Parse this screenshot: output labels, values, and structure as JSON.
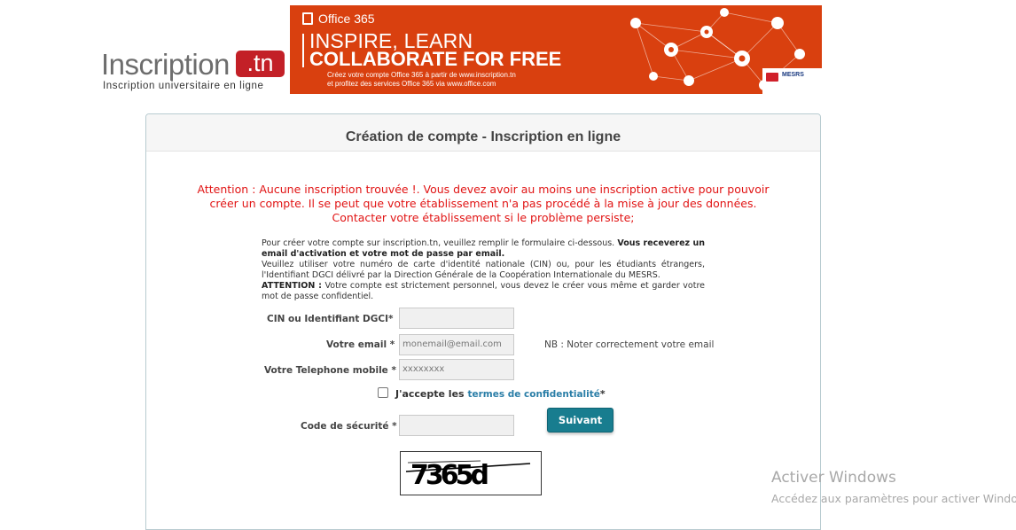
{
  "logo": {
    "word": "Inscription",
    "tld": ".tn",
    "tagline": "Inscription universitaire en ligne"
  },
  "banner": {
    "brand": "Office 365",
    "headline1": "INSPIRE, LEARN",
    "headline2": "COLLABORATE FOR FREE",
    "line1": "Créez votre compte Office 365 à partir de www.inscription.tn",
    "line2": "et profitez des services Office 365 via www.office.com",
    "badge": "MESRS",
    "accent": "#d9400f"
  },
  "panel": {
    "title": "Création de compte - Inscription en ligne"
  },
  "warning": {
    "line1": "Attention : Aucune inscription trouvée !. Vous devez avoir au moins une inscription active pour pouvoir",
    "line2": "créer un compte. Il se peut que votre établissement n'a pas procédé à la mise à jour des données.",
    "line3": "Contacter votre établissement si le problème persiste;"
  },
  "info": {
    "p1": "Pour créer votre compte sur inscription.tn, veuillez remplir le formulaire ci-dessous.",
    "p1_bold": "Vous receverez un email d'activation et votre mot de passe par email.",
    "p2": "Veuillez utiliser votre numéro de carte d'identité nationale (CIN) ou, pour les étudiants étrangers, l'Identifiant DGCI délivré par la Direction Générale de la Coopération Internationale du MESRS.",
    "p3_bold": "ATTENTION :",
    "p3": "Votre compte est strictement personnel, vous devez le créer vous même et garder votre mot de passe confidentiel."
  },
  "form": {
    "cin_label": "CIN ou Identifiant DGCI*",
    "cin_value": "",
    "email_label": "Votre email *",
    "email_placeholder": "monemail@email.com",
    "email_note": "NB : Noter correctement votre email",
    "phone_label": "Votre Telephone mobile *",
    "phone_placeholder": "xxxxxxxx",
    "accept_prefix": "J'accepte les",
    "accept_link": "termes de confidentialité",
    "accept_suffix": "*",
    "submit_label": "Suivant",
    "security_label": "Code de sécurité *",
    "security_value": "",
    "captcha_text": "7365d"
  },
  "watermark": {
    "title": "Activer Windows",
    "subtitle": "Accédez aux paramètres pour activer Windows."
  }
}
